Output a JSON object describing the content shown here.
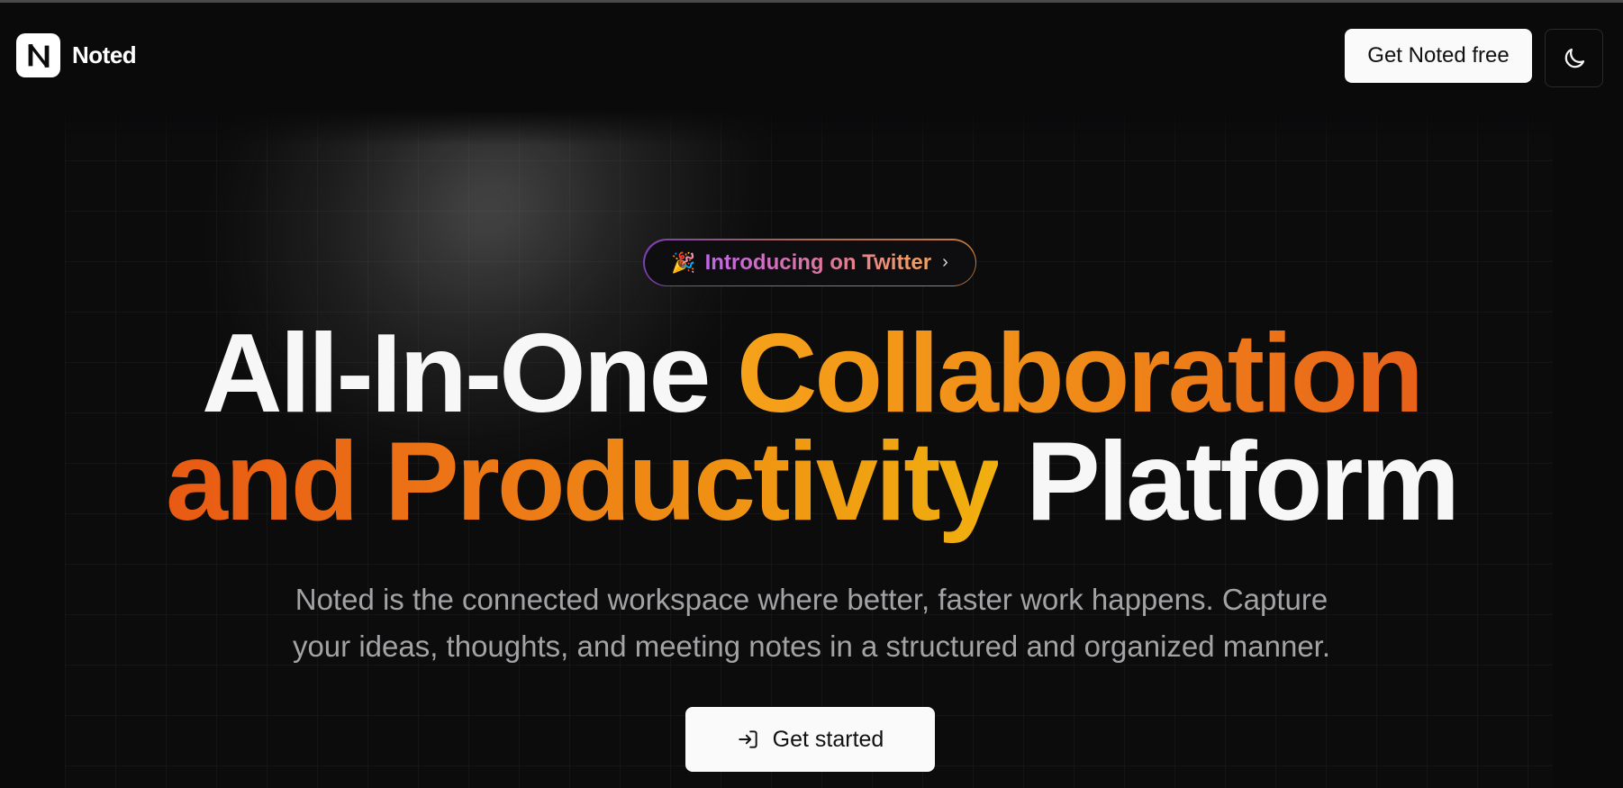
{
  "brand": {
    "name": "Noted",
    "mark_letter": "N"
  },
  "nav": {
    "cta_label": "Get Noted free",
    "theme_toggle_icon": "moon-icon"
  },
  "hero": {
    "badge": {
      "emoji": "🎉",
      "text": "Introducing on Twitter",
      "chevron": "›"
    },
    "headline": {
      "line1_white": "All-In-One ",
      "line1_accent": "Collaboration",
      "line2_accent": "and Productivity",
      "line2_white": " Platform"
    },
    "subtitle_line1": "Noted is the connected workspace where better, faster work happens. Capture",
    "subtitle_line2": "your ideas, thoughts, and meeting notes in a structured and organized manner.",
    "primary_cta": {
      "label": "Get started",
      "icon": "login-icon"
    }
  },
  "colors": {
    "background": "#0a0a0b",
    "accent_orange": "#f08a18",
    "accent_red_orange": "#e85a14",
    "accent_yellow": "#f1b00f",
    "button_bg": "#fafafa"
  }
}
